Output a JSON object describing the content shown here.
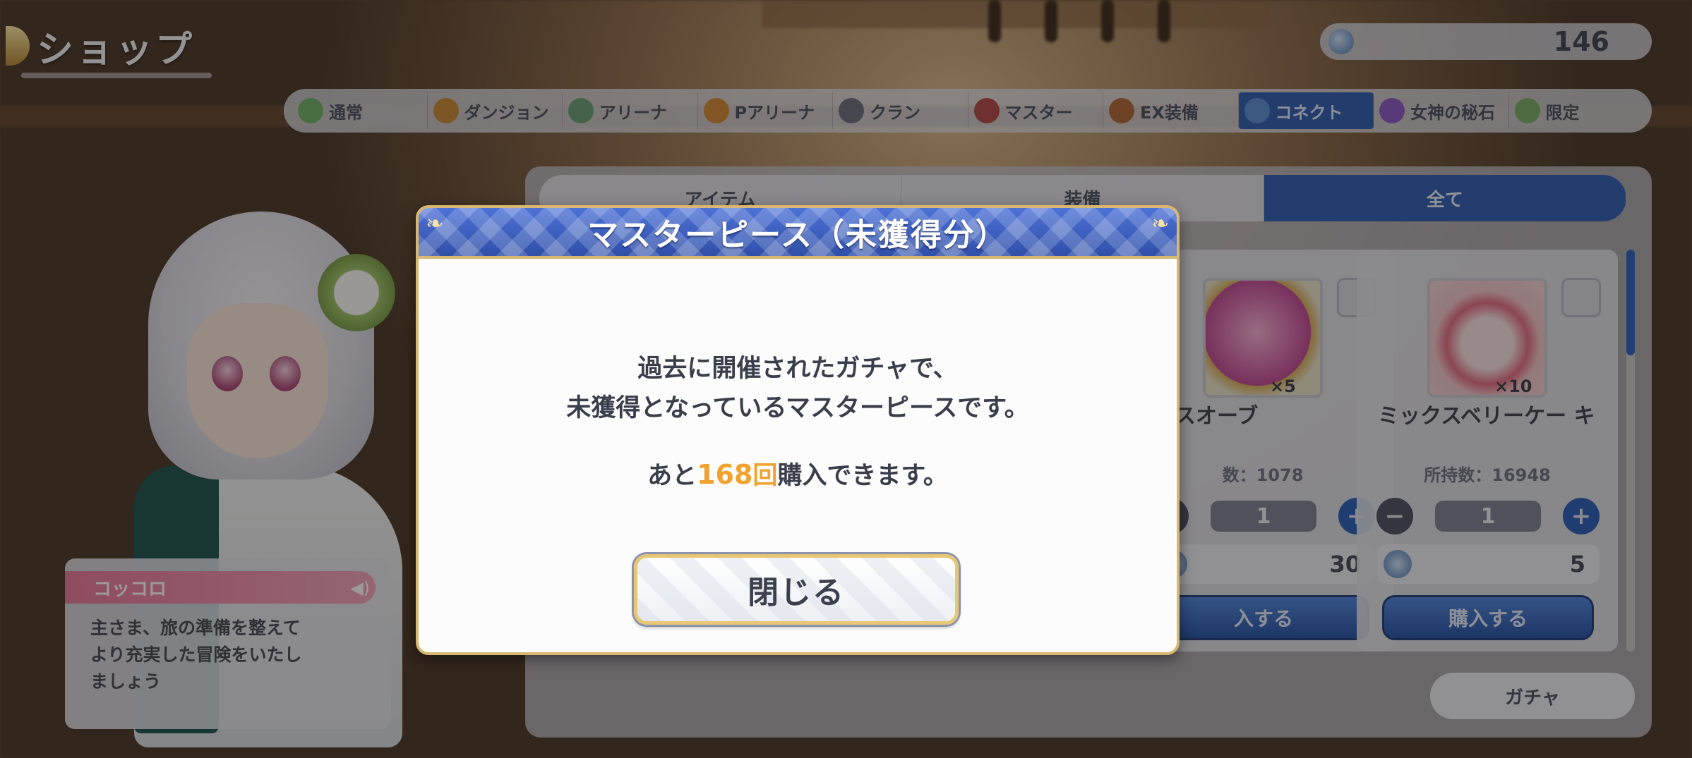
{
  "header": {
    "title": "ショップ",
    "currency_value": "146"
  },
  "category_tabs": [
    {
      "label": "通常",
      "icon": "coin-icon",
      "color": "#6fb16a"
    },
    {
      "label": "ダンジョン",
      "icon": "dungeon-coin-icon",
      "color": "#c98a3a"
    },
    {
      "label": "アリーナ",
      "icon": "arena-coin-icon",
      "color": "#6aa07a"
    },
    {
      "label": "Pアリーナ",
      "icon": "p-arena-coin-icon",
      "color": "#d28a38"
    },
    {
      "label": "クラン",
      "icon": "clan-coin-icon",
      "color": "#6b6f80"
    },
    {
      "label": "マスター",
      "icon": "master-coin-icon",
      "color": "#b04a4a"
    },
    {
      "label": "EX装備",
      "icon": "ex-equip-icon",
      "color": "#b06a3a"
    },
    {
      "label": "コネクト",
      "icon": "connect-coin-icon",
      "color": "#5a8fd8",
      "active": true
    },
    {
      "label": "女神の秘石",
      "icon": "goddess-stone-icon",
      "color": "#8a5ac8"
    },
    {
      "label": "限定",
      "icon": "limited-coin-icon",
      "color": "#7ab06a"
    }
  ],
  "sub_tabs": [
    "アイテム",
    "装備",
    "全て"
  ],
  "items": [
    {
      "name": "セスオーブ",
      "quantity": "×5",
      "owned": "数：1078",
      "count": "1",
      "price": "30",
      "buy_label": "入する"
    },
    {
      "name": "ミックスベリーケー キ",
      "quantity": "×10",
      "owned": "所持数：16948",
      "count": "1",
      "price": "5",
      "buy_label": "購入する"
    }
  ],
  "gacha_button": "ガチャ",
  "speech": {
    "speaker": "コッコロ",
    "message": "主さま、旅の準備を整えて\nより充実した冒険をいたし\nましょう"
  },
  "modal": {
    "title": "マスターピース（未獲得分）",
    "line1": "過去に開催されたガチャで、",
    "line2": "未獲得となっているマスターピースです。",
    "count_prefix": "あと",
    "count_value": "168",
    "count_unit": "回",
    "count_suffix": "購入できます。",
    "close_label": "閉じる"
  },
  "colors": {
    "accent_blue": "#2f5fb8",
    "modal_gold": "#d7b772",
    "count_orange": "#f0a22c"
  }
}
